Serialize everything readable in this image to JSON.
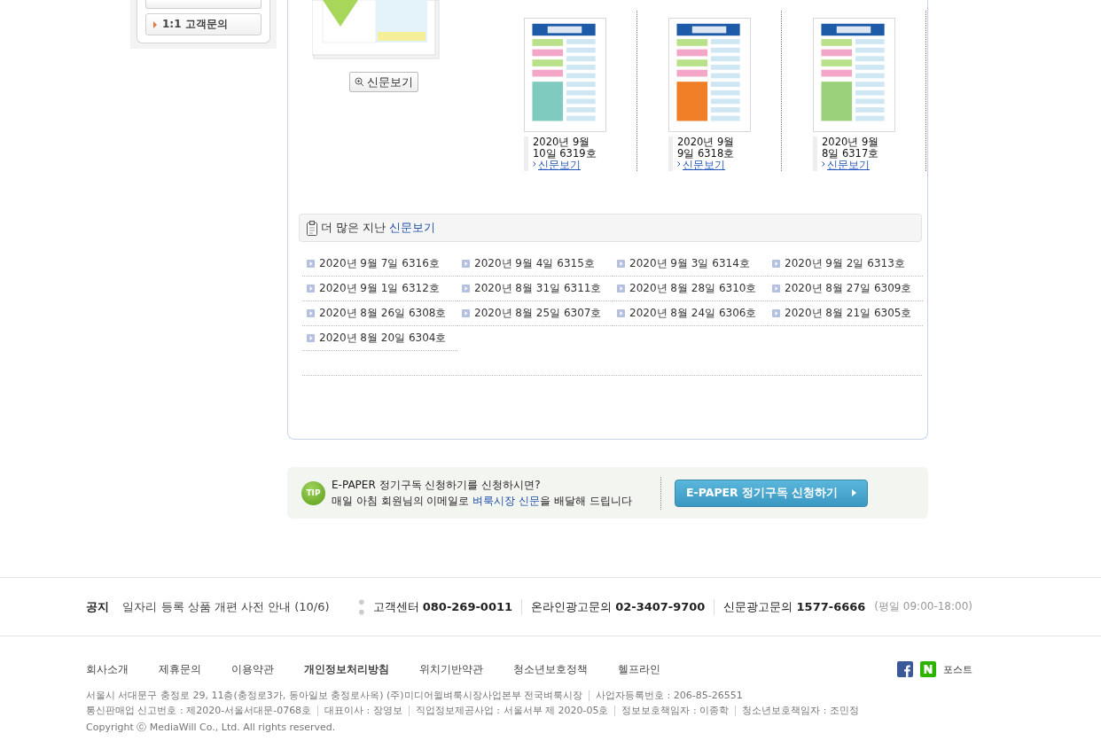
{
  "sidebar": {
    "items": [
      {
        "kind": "cut"
      },
      {
        "kind": "full",
        "label": "1:1 고객문의"
      }
    ]
  },
  "featured": {
    "button": "신문보기"
  },
  "issues": [
    {
      "date": "2020년 9월 10일 6319호",
      "link": "신문보기"
    },
    {
      "date": "2020년 9월 9일 6318호",
      "link": "신문보기"
    },
    {
      "date": "2020년 9월 8일 6317호",
      "link": "신문보기"
    }
  ],
  "archive": {
    "title": "더 많은 지난",
    "title_link": "신문보기",
    "items": [
      "2020년 9월 7일 6316호",
      "2020년 9월 4일 6315호",
      "2020년 9월 3일 6314호",
      "2020년 9월 2일 6313호",
      "2020년 9월 1일 6312호",
      "2020년 8월 31일 6311호",
      "2020년 8월 28일 6310호",
      "2020년 8월 27일 6309호",
      "2020년 8월 26일 6308호",
      "2020년 8월 25일 6307호",
      "2020년 8월 24일 6306호",
      "2020년 8월 21일 6305호",
      "2020년 8월 20일 6304호"
    ]
  },
  "tip": {
    "badge": "TIP",
    "line1": "E-PAPER 정기구독 신청하기를 신청하시면?",
    "line2_before": "매일 아침 회원님의 이메일로",
    "line2_link": "벼룩시장 신문",
    "line2_after": "을 배달해 드립니다",
    "button": "E-PAPER 정기구독 신청하기"
  },
  "footer": {
    "notice": {
      "label": "공지",
      "text": "일자리 등록 상품 개편 사전 안내 (10/6)"
    },
    "contacts": [
      {
        "label": "고객센터",
        "number": "080-269-0011"
      },
      {
        "label": "온라인광고문의",
        "number": "02-3407-9700"
      },
      {
        "label": "신문광고문의",
        "number": "1577-6666"
      }
    ],
    "hours": "(평일 09:00-18:00)",
    "links": [
      {
        "label": "회사소개",
        "bold": false
      },
      {
        "label": "제휴문의",
        "bold": false
      },
      {
        "label": "이용약관",
        "bold": false
      },
      {
        "label": "개인정보처리방침",
        "bold": true
      },
      {
        "label": "위치기반약관",
        "bold": false
      },
      {
        "label": "청소년보호정책",
        "bold": false
      },
      {
        "label": "헬프라인",
        "bold": false
      }
    ],
    "post": "포스트",
    "info_lines": [
      [
        "서울시 서대문구 충정로 29, 11층(충정로3가, 동아일보 충정로사옥) (주)미디어윌벼룩시장사업본부 전국벼룩시장",
        "사업자등록번호 : 206-85-26551"
      ],
      [
        "통신판매업 신고번호 : 제2020-서울서대문-0768호",
        "대표이사 : 장영보",
        "직업정보제공사업 : 서울서부 제 2020-05호",
        "정보보호책임자 : 이종학",
        "청소년보호책임자 : 조민정"
      ]
    ],
    "copyright": "Copyright ⓒ MediaWill Co., Ltd. All rights reserved."
  }
}
